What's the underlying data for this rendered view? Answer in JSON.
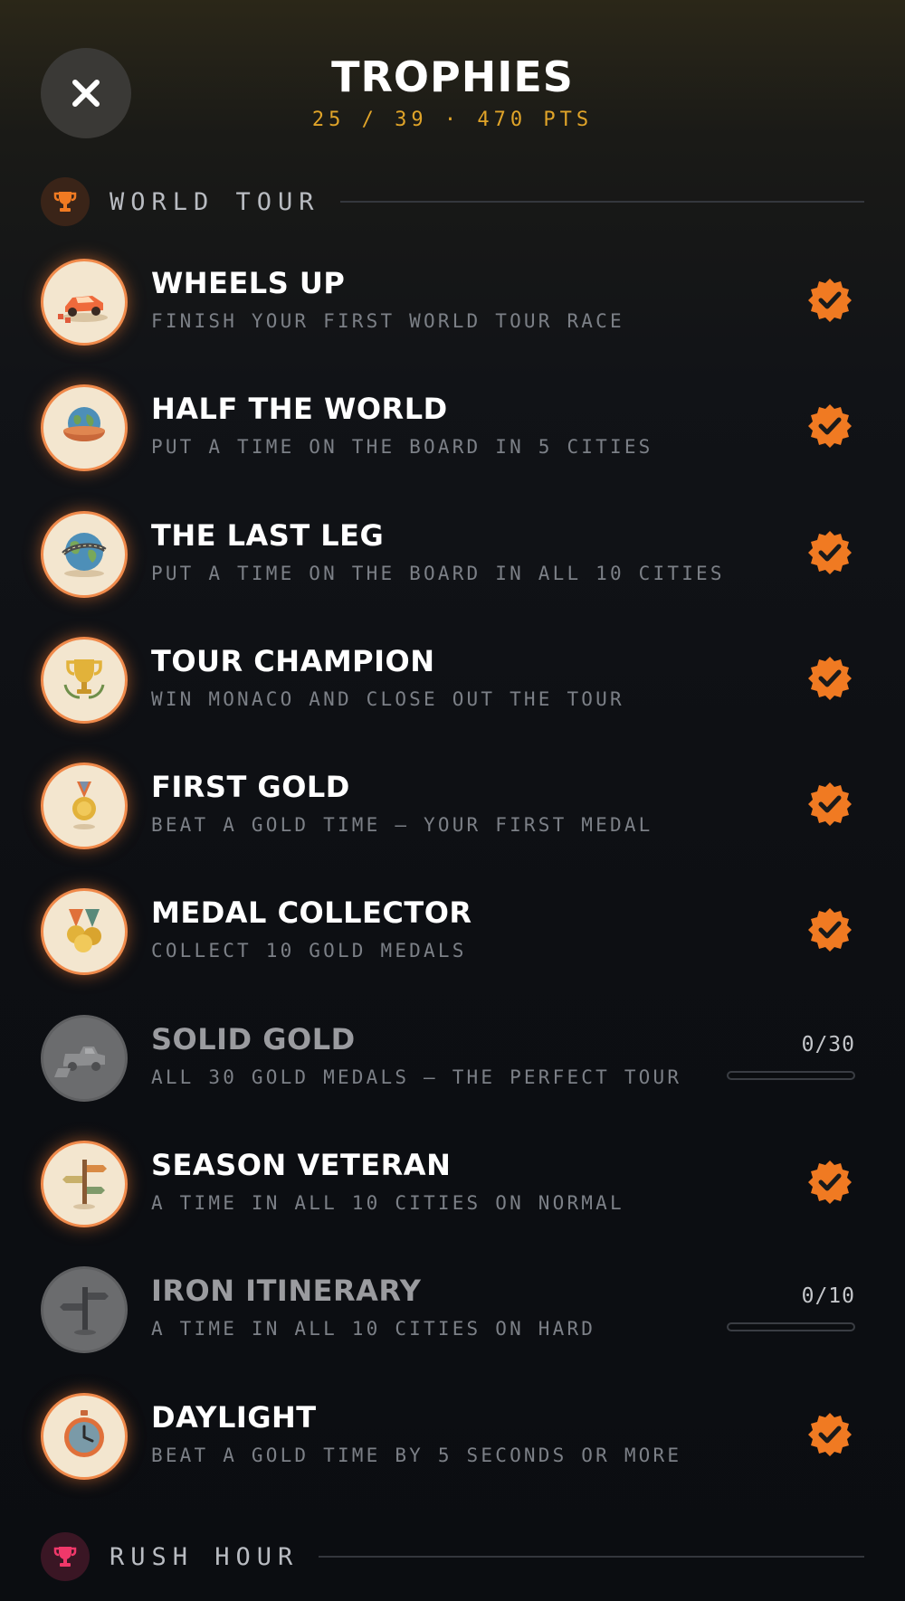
{
  "header": {
    "title": "TROPHIES",
    "subtitle": "25 / 39 · 470 PTS",
    "close_icon": "close-icon"
  },
  "sections": [
    {
      "label": "WORLD TOUR",
      "icon": "trophy-icon",
      "icon_color": "#f07a22",
      "bg": "#3a2418"
    },
    {
      "label": "RUSH HOUR",
      "icon": "trophy-icon",
      "icon_color": "#f0386a",
      "bg": "#3a1624"
    }
  ],
  "trophies": [
    {
      "title": "WHEELS UP",
      "desc": "FINISH YOUR FIRST WORLD TOUR RACE",
      "unlocked": true,
      "icon": "race-car-icon"
    },
    {
      "title": "HALF THE WORLD",
      "desc": "PUT A TIME ON THE BOARD IN 5 CITIES",
      "unlocked": true,
      "icon": "globe-bowl-icon"
    },
    {
      "title": "THE LAST LEG",
      "desc": "PUT A TIME ON THE BOARD IN ALL 10 CITIES",
      "unlocked": true,
      "icon": "globe-road-icon"
    },
    {
      "title": "TOUR CHAMPION",
      "desc": "WIN MONACO AND CLOSE OUT THE TOUR",
      "unlocked": true,
      "icon": "trophy-cup-icon"
    },
    {
      "title": "FIRST GOLD",
      "desc": "BEAT A GOLD TIME — YOUR FIRST MEDAL",
      "unlocked": true,
      "icon": "gold-medal-icon"
    },
    {
      "title": "MEDAL COLLECTOR",
      "desc": "COLLECT 10 GOLD MEDALS",
      "unlocked": true,
      "icon": "medals-icon"
    },
    {
      "title": "SOLID GOLD",
      "desc": "ALL 30 GOLD MEDALS — THE PERFECT TOUR",
      "unlocked": false,
      "icon": "truck-icon",
      "progress_text": "0/30",
      "progress": 0
    },
    {
      "title": "SEASON VETERAN",
      "desc": "A TIME IN ALL 10 CITIES ON NORMAL",
      "unlocked": true,
      "icon": "signpost-icon"
    },
    {
      "title": "IRON ITINERARY",
      "desc": "A TIME IN ALL 10 CITIES ON HARD",
      "unlocked": false,
      "icon": "iron-signpost-icon",
      "progress_text": "0/10",
      "progress": 0
    },
    {
      "title": "DAYLIGHT",
      "desc": "BEAT A GOLD TIME BY 5 SECONDS OR MORE",
      "unlocked": true,
      "icon": "stopwatch-icon"
    }
  ],
  "colors": {
    "accent": "#f07a22",
    "gold_text": "#e0a429"
  }
}
